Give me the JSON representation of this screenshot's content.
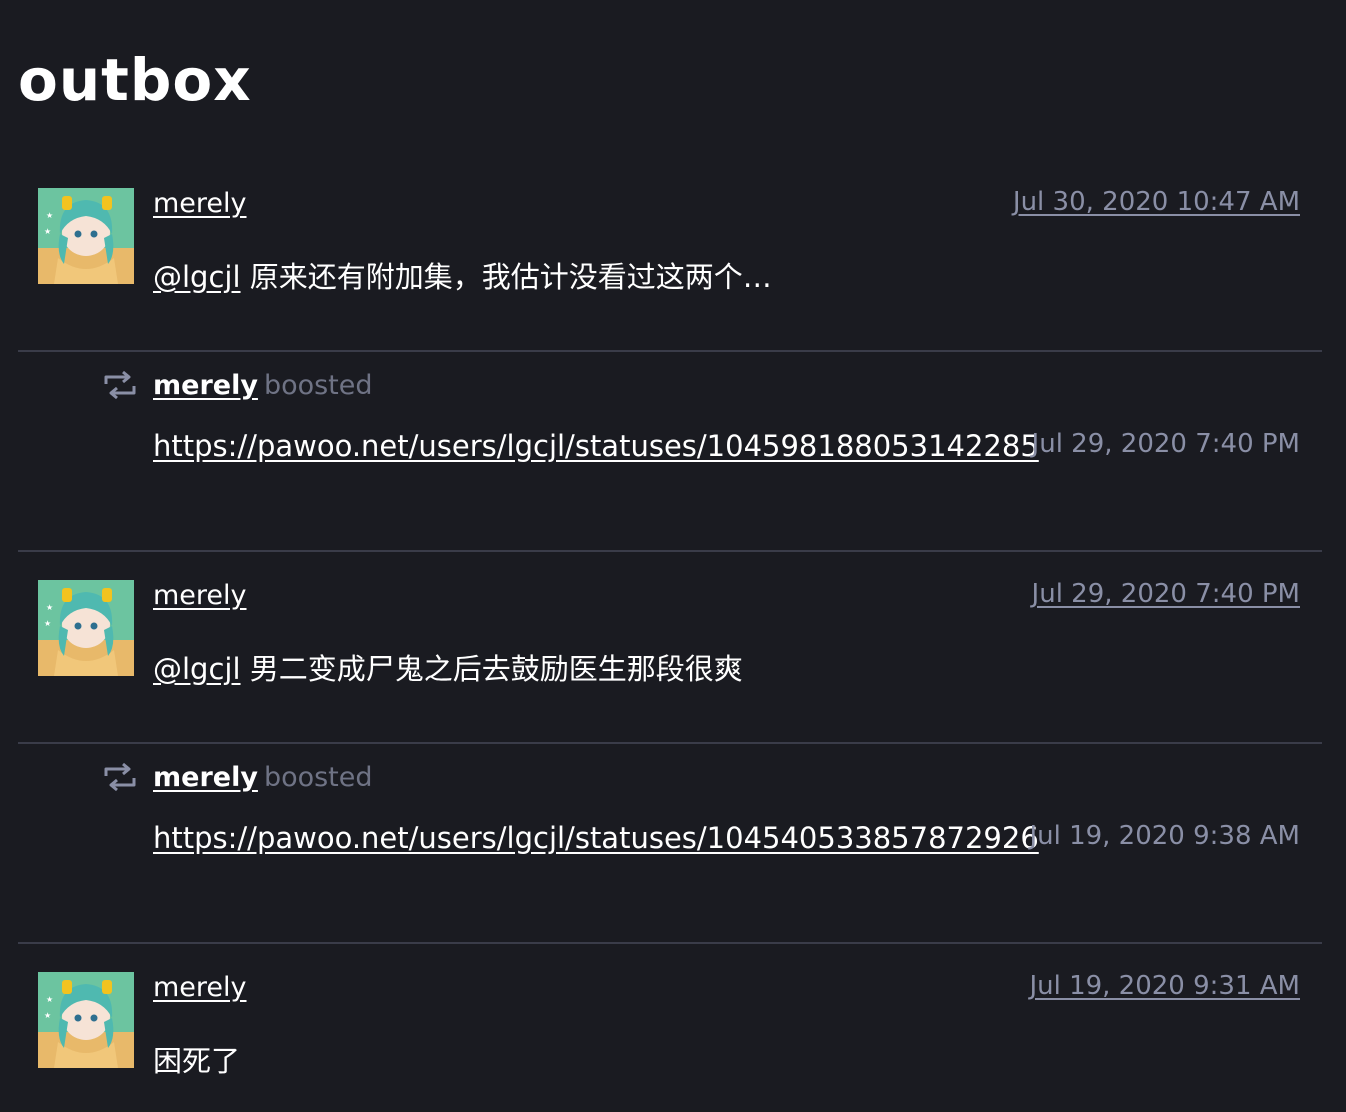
{
  "page": {
    "title": "outbox"
  },
  "colors": {
    "background": "#1a1b21",
    "divider": "#3a3c49",
    "muted_text": "#8a8fa6",
    "text": "#ffffff"
  },
  "feed": [
    {
      "type": "status",
      "username": "merely",
      "timestamp": "Jul 30, 2020 10:47 AM",
      "mention": "@lgcjl",
      "text": "原来还有附加集，我估计没看过这两个…"
    },
    {
      "type": "boost",
      "icon": "repeat-icon",
      "username": "merely",
      "boosted_label": "boosted",
      "link": "https://pawoo.net/users/lgcjl/statuses/104598188053142285",
      "timestamp": "Jul 29, 2020 7:40 PM"
    },
    {
      "type": "status",
      "username": "merely",
      "timestamp": "Jul 29, 2020 7:40 PM",
      "mention": "@lgcjl",
      "text": "男二变成尸鬼之后去鼓励医生那段很爽"
    },
    {
      "type": "boost",
      "icon": "repeat-icon",
      "username": "merely",
      "boosted_label": "boosted",
      "link": "https://pawoo.net/users/lgcjl/statuses/104540533857872926",
      "timestamp": "Jul 19, 2020 9:38 AM"
    },
    {
      "type": "status",
      "username": "merely",
      "timestamp": "Jul 19, 2020 9:31 AM",
      "mention": "",
      "text": "困死了"
    }
  ]
}
